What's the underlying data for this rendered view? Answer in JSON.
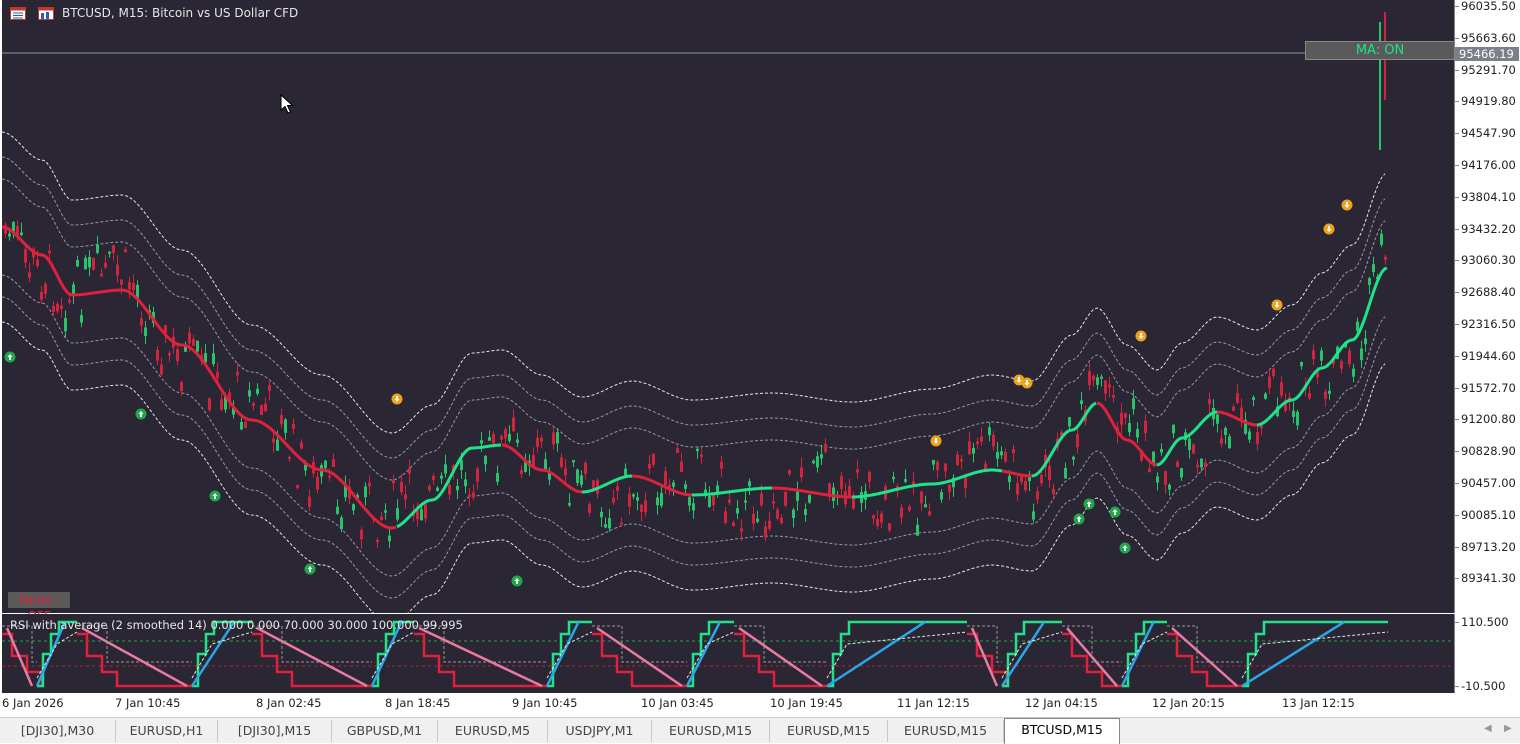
{
  "chart": {
    "title": "BTCUSD, M15:  Bitcoin vs US Dollar CFD",
    "ma_status": "MA: ON",
    "panel_status": "Panel : OFF",
    "current_price": "95466.19"
  },
  "price_axis": {
    "ticks": [
      "96035.50",
      "95663.60",
      "95291.70",
      "94919.80",
      "94547.90",
      "94176.00",
      "93804.10",
      "93432.20",
      "93060.30",
      "92688.40",
      "92316.50",
      "91944.60",
      "91572.70",
      "91200.80",
      "90828.90",
      "90457.00",
      "90085.10",
      "89713.20",
      "89341.30"
    ]
  },
  "rsi_panel": {
    "title": "RSI with average (2 smoothed 14) 0.000 0.000 70.000 30.000 100.000 99.995",
    "ticks": [
      "110.500",
      "-10.500"
    ]
  },
  "time_axis": {
    "labels": [
      "6 Jan 2026",
      "7 Jan 10:45",
      "8 Jan 02:45",
      "8 Jan 18:45",
      "9 Jan 10:45",
      "10 Jan 03:45",
      "10 Jan 19:45",
      "11 Jan 12:15",
      "12 Jan 04:15",
      "12 Jan 20:15",
      "13 Jan 12:15"
    ]
  },
  "tabs": [
    {
      "label": "[DJI30],M30"
    },
    {
      "label": "EURUSD,H1"
    },
    {
      "label": "[DJI30],M15"
    },
    {
      "label": "GBPUSD,M1"
    },
    {
      "label": "EURUSD,M5"
    },
    {
      "label": "USDJPY,M1"
    },
    {
      "label": "EURUSD,M15"
    },
    {
      "label": "EURUSD,M15"
    },
    {
      "label": "EURUSD,M15"
    },
    {
      "label": "BTCUSD,M15"
    }
  ],
  "colors": {
    "background": "#2a2633",
    "bull": "#1ee38a",
    "bear": "#e0213d",
    "rsi_blue": "#2aa7e8",
    "rsi_pink": "#e87aa4",
    "arrow_up": "#1fa84a",
    "arrow_down": "#f0a21a"
  }
}
